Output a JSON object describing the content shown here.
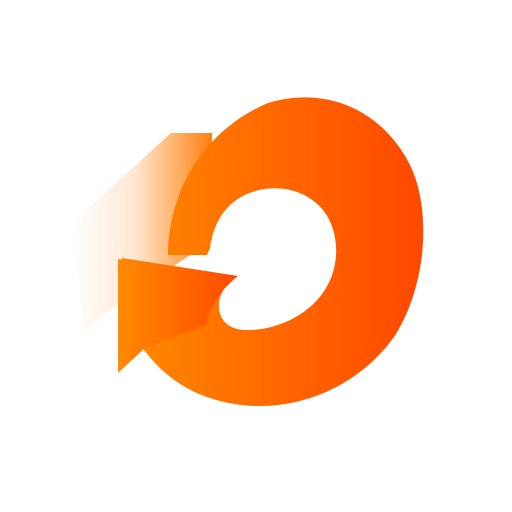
{
  "icon": {
    "name": "refresh-arrow-icon",
    "colors": {
      "background": "#ffffff",
      "gradient_left": "#ff8a00",
      "gradient_right": "#ff4800",
      "trail": "#ff7a00"
    }
  }
}
